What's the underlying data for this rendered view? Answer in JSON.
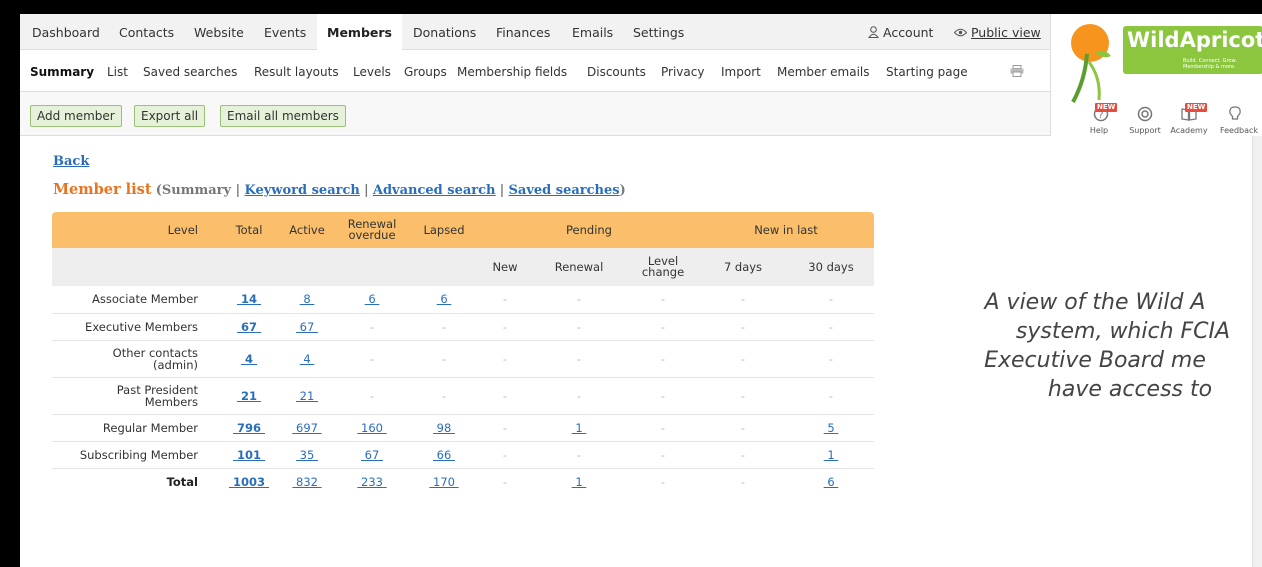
{
  "topnav": {
    "items": [
      "Dashboard",
      "Contacts",
      "Website",
      "Events",
      "Members",
      "Donations",
      "Finances",
      "Emails",
      "Settings"
    ],
    "account": "Account",
    "public_view": "Public view"
  },
  "subnav": {
    "items": [
      "Summary",
      "List",
      "Saved searches",
      "Result layouts",
      "Levels",
      "Groups",
      "Membership fields",
      "Discounts",
      "Privacy",
      "Import",
      "Member emails",
      "Starting page"
    ]
  },
  "toolbar": {
    "add_member": "Add member",
    "export_all": "Export all",
    "email_all": "Email all members"
  },
  "logo": {
    "name": "WildApricot",
    "tagline": "Build. Connect. Grow. Membership & more."
  },
  "help": {
    "items": [
      "Help",
      "Support",
      "Academy",
      "Feedback"
    ],
    "new_badge": "NEW"
  },
  "page": {
    "back": "Back",
    "title": "Member list",
    "summary": "(Summary |",
    "keyword_search": "Keyword search",
    "advanced_search": "Advanced search",
    "saved_searches": "Saved searches",
    "sep": "|",
    "close": ")"
  },
  "table": {
    "headers": {
      "level": "Level",
      "total": "Total",
      "active": "Active",
      "renewal_overdue": "Renewal overdue",
      "lapsed": "Lapsed",
      "pending": "Pending",
      "new_in_last": "New in last",
      "new": "New",
      "renewal": "Renewal",
      "level_change": "Level change",
      "d7": "7 days",
      "d30": "30 days"
    },
    "rows": [
      {
        "level": "Associate Member",
        "total": "14",
        "active": "8",
        "overdue": "6",
        "lapsed": "6",
        "new": "-",
        "renewal": "-",
        "change": "-",
        "d7": "-",
        "d30": "-"
      },
      {
        "level": "Executive Members",
        "total": "67",
        "active": "67",
        "overdue": "-",
        "lapsed": "-",
        "new": "-",
        "renewal": "-",
        "change": "-",
        "d7": "-",
        "d30": "-"
      },
      {
        "level": "Other contacts (admin)",
        "total": "4",
        "active": "4",
        "overdue": "-",
        "lapsed": "-",
        "new": "-",
        "renewal": "-",
        "change": "-",
        "d7": "-",
        "d30": "-"
      },
      {
        "level": "Past President Members",
        "total": "21",
        "active": "21",
        "overdue": "-",
        "lapsed": "-",
        "new": "-",
        "renewal": "-",
        "change": "-",
        "d7": "-",
        "d30": "-"
      },
      {
        "level": "Regular Member",
        "total": "796",
        "active": "697",
        "overdue": "160",
        "lapsed": "98",
        "new": "-",
        "renewal": "1",
        "change": "-",
        "d7": "-",
        "d30": "5"
      },
      {
        "level": "Subscribing Member",
        "total": "101",
        "active": "35",
        "overdue": "67",
        "lapsed": "66",
        "new": "-",
        "renewal": "-",
        "change": "-",
        "d7": "-",
        "d30": "1"
      },
      {
        "level": "Total",
        "total": "1003",
        "active": "832",
        "overdue": "233",
        "lapsed": "170",
        "new": "-",
        "renewal": "1",
        "change": "-",
        "d7": "-",
        "d30": "6"
      }
    ]
  },
  "caption": {
    "lines": [
      "A view of the Wild A",
      "system, which FCIA",
      "Executive Board me",
      "have access to"
    ]
  }
}
